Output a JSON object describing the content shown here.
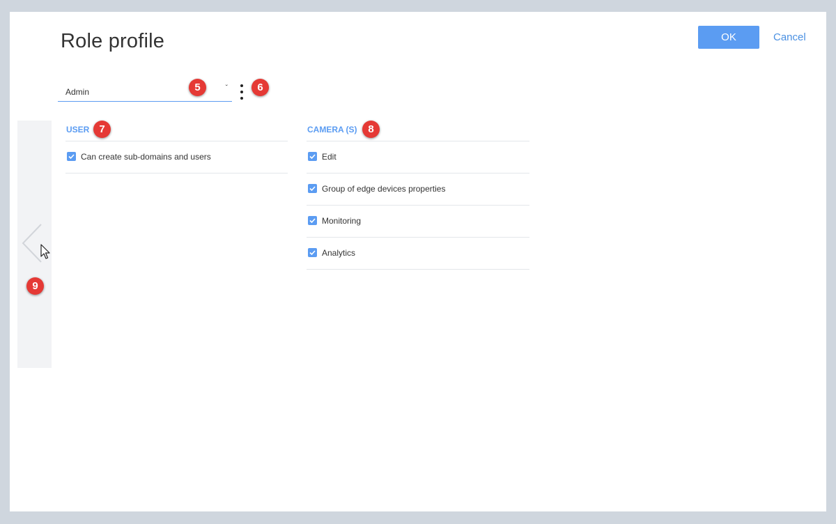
{
  "dialog": {
    "title": "Role profile",
    "ok_label": "OK",
    "cancel_label": "Cancel"
  },
  "role_select": {
    "value": "Admin"
  },
  "markers": [
    "5",
    "6",
    "7",
    "8",
    "9"
  ],
  "sections": {
    "user": {
      "heading": "USER",
      "items": [
        {
          "label": "Can create sub-domains and users",
          "checked": true
        }
      ]
    },
    "camera": {
      "heading": "CAMERA (S)",
      "items": [
        {
          "label": "Edit",
          "checked": true
        },
        {
          "label": "Group of edge devices properties",
          "checked": true
        },
        {
          "label": "Monitoring",
          "checked": true
        },
        {
          "label": "Analytics",
          "checked": true
        }
      ]
    }
  },
  "icons": {
    "dropdown": "chevron-down-icon",
    "more": "kebab-menu-icon",
    "back": "chevron-left-icon",
    "check": "check-icon",
    "cursor": "mouse-pointer-icon"
  },
  "colors": {
    "accent": "#5b9cf2",
    "marker": "#e53935",
    "backdrop": "#cfd6de",
    "panel": "#f2f3f5"
  }
}
